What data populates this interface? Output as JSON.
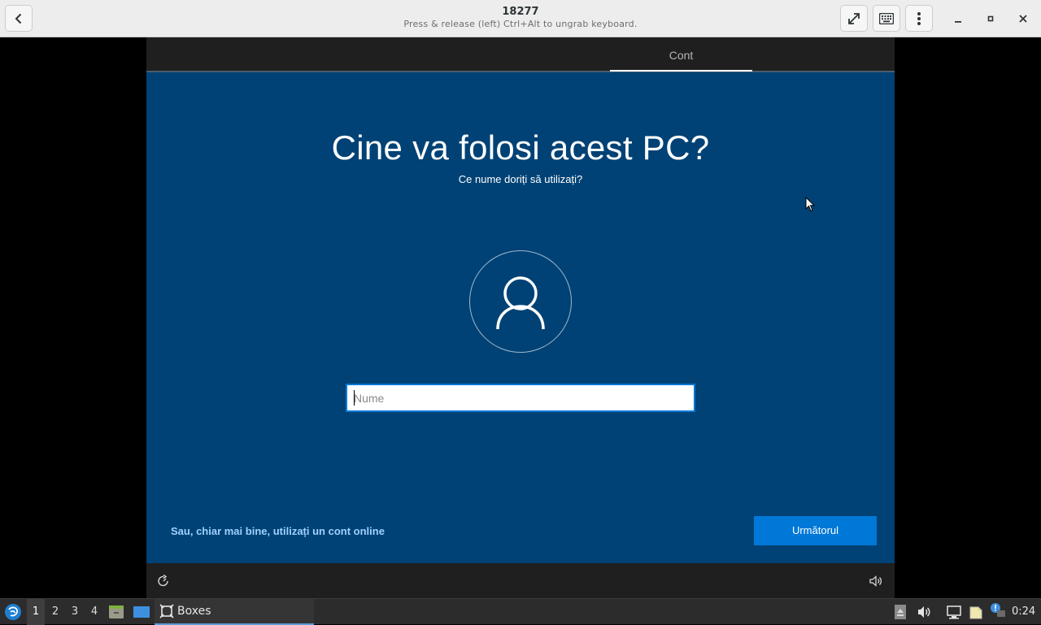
{
  "header": {
    "title": "18277",
    "subtitle": "Press & release (left) Ctrl+Alt to ungrab keyboard.",
    "back_icon": "chevron-left-icon",
    "fullscreen_icon": "expand-icon",
    "keyboard_icon": "keyboard-icon",
    "menu_icon": "vertical-dots-icon"
  },
  "vm": {
    "tab_label": "Cont",
    "title": "Cine va folosi acest PC?",
    "subtitle": "Ce nume doriți să utilizați?",
    "avatar_icon": "user-icon",
    "name_input": {
      "placeholder": "Nume",
      "value": ""
    },
    "online_account_link": "Sau, chiar mai bine, utilizați un cont online",
    "next_button": "Următorul",
    "accent_color": "#0078d7",
    "background_color": "#004275"
  },
  "taskbar": {
    "workspaces": [
      "1",
      "2",
      "3",
      "4"
    ],
    "active_workspace": "1",
    "task_label": "Boxes",
    "clock": "0:24"
  }
}
